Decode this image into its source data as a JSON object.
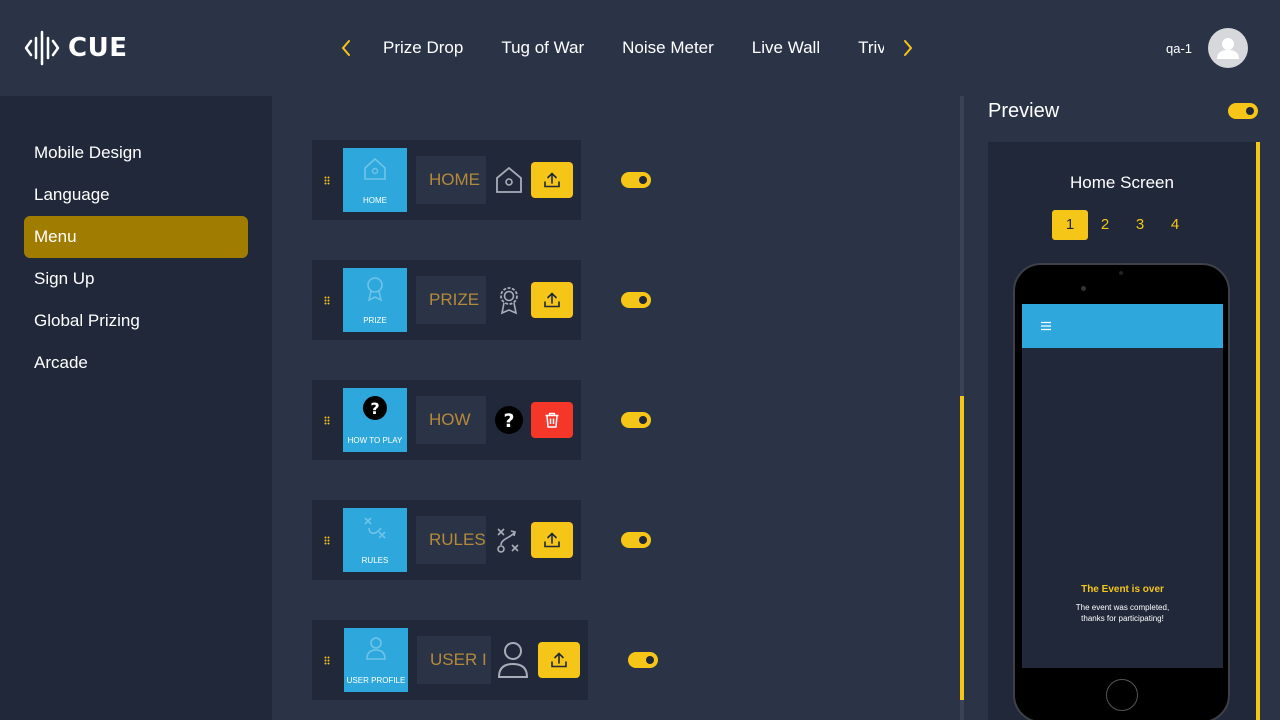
{
  "header": {
    "logo_text": "CUE",
    "tabs": [
      "Prize Drop",
      "Tug of War",
      "Noise Meter",
      "Live Wall",
      "Trivia"
    ],
    "user_name": "qa-1",
    "accent": "#f5c518"
  },
  "sidebar": {
    "items": [
      {
        "label": "Mobile Design"
      },
      {
        "label": "Language"
      },
      {
        "label": "Menu"
      },
      {
        "label": "Sign Up"
      },
      {
        "label": "Global Prizing"
      },
      {
        "label": "Arcade"
      }
    ],
    "active": "Menu",
    "active_color": "#a07d00"
  },
  "menu_items": [
    {
      "tile_label": "HOME",
      "name_value": "HOME",
      "icon": "home-icon",
      "action": "upload",
      "enabled": true
    },
    {
      "tile_label": "PRIZE",
      "name_value": "PRIZE",
      "icon": "award-icon",
      "action": "upload",
      "enabled": true
    },
    {
      "tile_label": "HOW TO PLAY",
      "name_value": "HOW",
      "icon": "question-icon",
      "action": "delete",
      "enabled": true
    },
    {
      "tile_label": "RULES",
      "name_value": "RULES",
      "icon": "strategy-icon",
      "action": "upload",
      "enabled": true
    },
    {
      "tile_label": "USER PROFILE",
      "name_value": "USER I",
      "icon": "user-icon",
      "action": "upload",
      "enabled": true
    }
  ],
  "preview": {
    "title": "Preview",
    "enabled": true,
    "screen_title": "Home Screen",
    "pages": [
      "1",
      "2",
      "3",
      "4"
    ],
    "active_page": "1",
    "event_title": "The Event is over",
    "event_message_line1": "The event was completed,",
    "event_message_line2": "thanks for participating!",
    "bar_color": "#2ea8dc"
  }
}
